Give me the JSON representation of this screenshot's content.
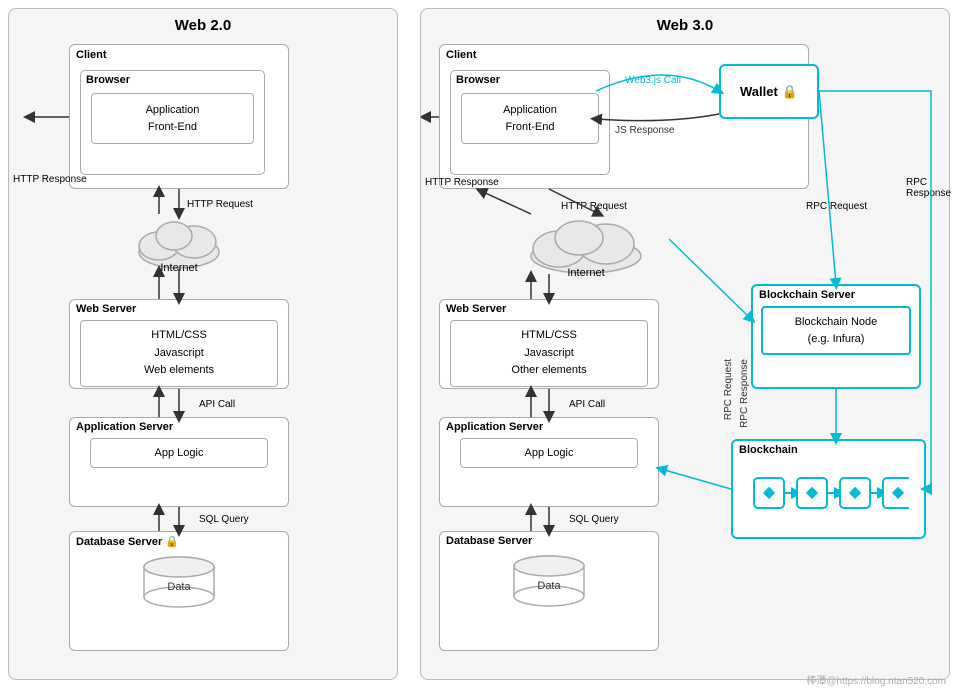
{
  "web2": {
    "title": "Web 2.0",
    "client": {
      "label": "Client",
      "browser": {
        "label": "Browser",
        "inner": "Application\nFront-End"
      }
    },
    "http_response": "HTTP Response",
    "http_request": "HTTP Request",
    "internet": "Internet",
    "web_server": {
      "label": "Web Server",
      "inner": "HTML/CSS\nJavascript\nWeb elements"
    },
    "api_call": "API Call",
    "app_server": {
      "label": "Application Server",
      "inner": "App Logic"
    },
    "sql_query": "SQL Query",
    "db_server": {
      "label": "Database Server",
      "inner": "Data"
    }
  },
  "web3": {
    "title": "Web 3.0",
    "client": {
      "label": "Client",
      "browser": {
        "label": "Browser",
        "inner": "Application\nFront-End"
      }
    },
    "web3js_call": "Web3.js Call",
    "js_response": "JS Response",
    "wallet": "Wallet",
    "http_response": "HTTP Response",
    "http_request": "HTTP Request",
    "rpc_request_right": "RPC Request",
    "rpc_response_right": "RPC Response",
    "internet": "Internet",
    "web_server": {
      "label": "Web Server",
      "inner": "HTML/CSS\nJavascript\nOther elements"
    },
    "api_call": "API Call",
    "app_server": {
      "label": "Application Server",
      "inner": "App Logic"
    },
    "sql_query": "SQL Query",
    "db_server": {
      "label": "Database Server",
      "inner": "Data"
    },
    "blockchain_server": {
      "label": "Blockchain Server",
      "inner": "Blockchain Node\n(e.g. Infura)"
    },
    "rpc_request_mid": "RPC Request",
    "rpc_response_mid": "RPC Response",
    "blockchain": {
      "label": "Blockchain"
    }
  },
  "watermark": "棒潭@https://blog.ntan520.com"
}
